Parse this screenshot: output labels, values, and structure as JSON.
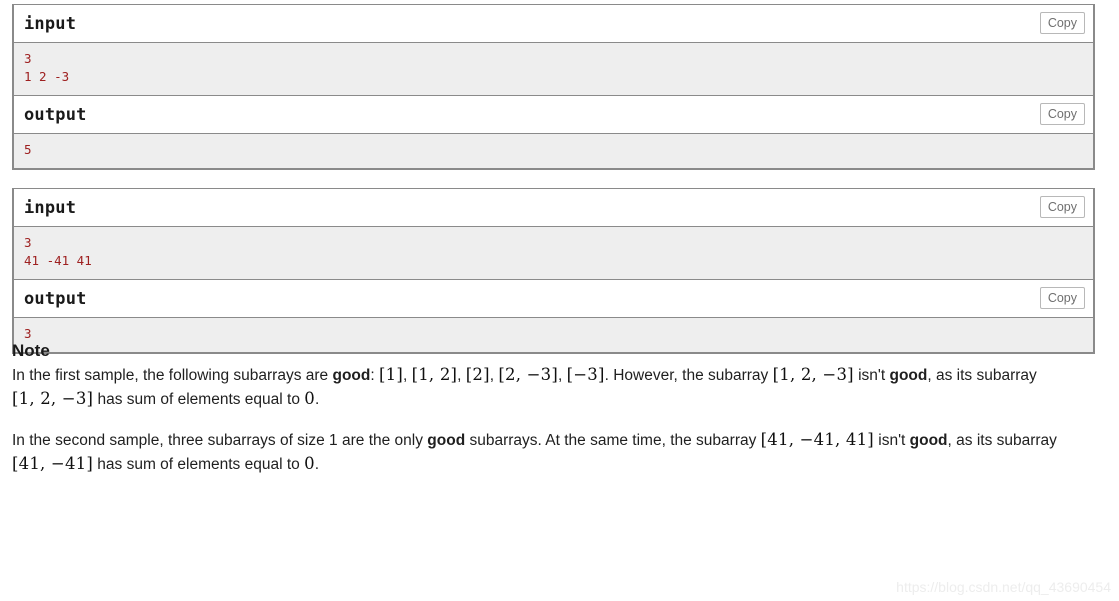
{
  "samples": [
    {
      "input_label": "input",
      "input_copy_label": "Copy",
      "input_lines": [
        "3",
        "1 2 -3"
      ],
      "output_label": "output",
      "output_copy_label": "Copy",
      "output_lines": [
        "5"
      ]
    },
    {
      "input_label": "input",
      "input_copy_label": "Copy",
      "input_lines": [
        "3",
        "41 -41 41"
      ],
      "output_label": "output",
      "output_copy_label": "Copy",
      "output_lines": [
        "3"
      ]
    }
  ],
  "note": {
    "title": "Note",
    "paragraph1": {
      "t1": "In the first sample, the following subarrays are ",
      "kw1": "good",
      "t2": ": ",
      "m1": "[1]",
      "t3": ", ",
      "m2": "[1, 2]",
      "t4": ", ",
      "m3": "[2]",
      "t5": ", ",
      "m4": "[2, −3]",
      "t6": ", ",
      "m5": "[−3]",
      "t7": ". However, the subarray ",
      "m6": "[1, 2, −3]",
      "t8": " isn't ",
      "kw2": "good",
      "t9": ", as its subarray ",
      "m7": "[1, 2, −3]",
      "t10": " has sum of elements equal to ",
      "m8": "0",
      "t11": "."
    },
    "paragraph2": {
      "t1": "In the second sample, three subarrays of size 1 are the only ",
      "kw1": "good",
      "t2": " subarrays. At the same time, the subarray ",
      "m1": "[41, −41, 41]",
      "t3": " isn't ",
      "kw2": "good",
      "t4": ", as its subarray ",
      "m2": "[41, −41]",
      "t5": " has sum of elements equal to ",
      "m3": "0",
      "t6": "."
    }
  },
  "watermark": {
    "text": "https://blog.csdn.net/qq_43690454"
  },
  "colors": {
    "sample_data_bg": "#eeeeee",
    "sample_border": "#8a8a8a",
    "sample_text": "#9e2020",
    "copy_border": "#b8b8b8",
    "copy_text": "#6f6f6f",
    "watermark": "#ededed"
  }
}
